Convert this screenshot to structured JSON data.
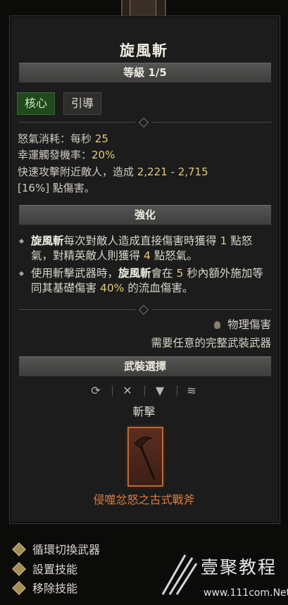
{
  "skill": {
    "title": "旋風斬",
    "level": "等級 1/5",
    "tags": [
      "核心",
      "引導"
    ],
    "stats": {
      "line1_label": "怒氣消耗：每秒",
      "line1_value": "25",
      "line2_label": "幸運觸發機率：",
      "line2_value": "20%",
      "line3_prefix": "快速攻擊附近敵人，造成",
      "line3_value": "2,221 - 2,715",
      "line4": "[16%] 點傷害。"
    }
  },
  "enhance": {
    "header": "強化",
    "bullet1": {
      "b1": "旋風斬",
      "t1": "每次對敵人造成直接傷害時獲得",
      "v1": "1",
      "t2": "點怒氣，對精英敵人則獲得",
      "v2": "4",
      "t3": "點怒氣。"
    },
    "bullet2": {
      "t1": "使用斬擊武器時，",
      "b1": "旋風斬",
      "t2": "會在",
      "v1": "5",
      "t3": "秒內額外施加等同其基礎傷害",
      "v2": "40%",
      "t4": "的流血傷害。"
    }
  },
  "damage_type": "物理傷害",
  "requirement": "需要任意的完整武裝武器",
  "arsenal": {
    "header": "武裝選擇",
    "icons": [
      "swap-icon",
      "crossed-swords-icon",
      "funnel-icon",
      "wifi-icon"
    ],
    "weapon_type": "斬擊",
    "weapon_name": "侵噬忿怒之古式戰斧",
    "weapon_color": "#e07b3e"
  },
  "menu": [
    "循環切換武器",
    "設置技能",
    "移除技能"
  ],
  "watermark": {
    "text": "壹聚教程",
    "url": "www.111com.Net"
  },
  "colors": {
    "accent_yellow": "#e6c87a",
    "core_tag": "#1f4a1c"
  }
}
